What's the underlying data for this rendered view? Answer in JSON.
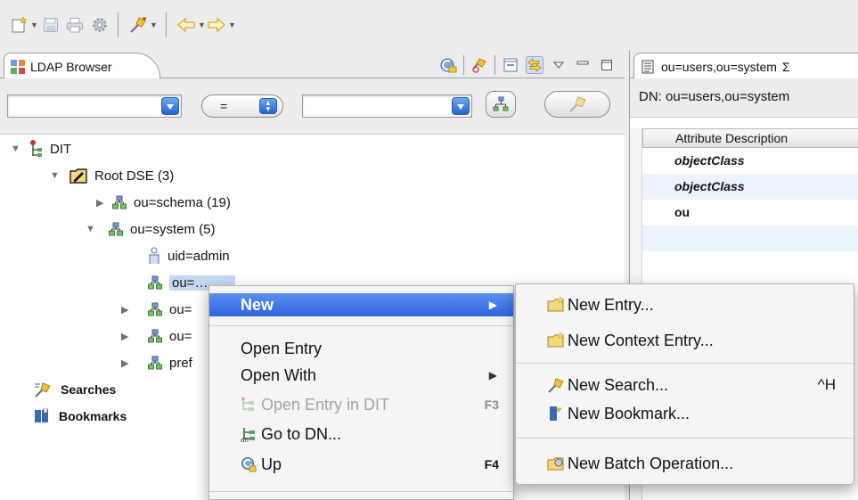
{
  "toolbar": {
    "items": [
      "new-wizard-icon",
      "save-icon",
      "print-icon",
      "preferences-icon",
      "search-icon",
      "back-icon",
      "forward-icon"
    ]
  },
  "left_view": {
    "tab_title": "LDAP Browser",
    "tools": [
      "connection-refresh-icon",
      "link-icon",
      "collapse-all-icon",
      "link-with-editor-icon",
      "view-menu-icon",
      "minimize-icon",
      "maximize-icon"
    ]
  },
  "filter": {
    "attribute_value": "",
    "operator": "=",
    "value": ""
  },
  "tree": {
    "dit": "DIT",
    "root_dse": "Root DSE (3)",
    "schema": "ou=schema (19)",
    "system": "ou=system (5)",
    "admin": "uid=admin",
    "selected_entry": "ou=…",
    "entry_3": "ou=",
    "entry_4": "ou=",
    "entry_5": "pref",
    "searches": "Searches",
    "bookmarks": "Bookmarks"
  },
  "editor": {
    "tab_title": "ou=users,ou=system",
    "close_glyph": "Σ",
    "dn": "DN: ou=users,ou=system",
    "column_header": "Attribute Description",
    "rows": [
      "objectClass",
      "objectClass",
      "ou"
    ]
  },
  "context_menu": {
    "new": "New",
    "open_entry": "Open Entry",
    "open_with": "Open With",
    "open_in_dit": "Open Entry in DIT",
    "open_in_dit_key": "F3",
    "go_to_dn": "Go to DN...",
    "up": "Up",
    "up_key": "F4"
  },
  "new_submenu": {
    "new_entry": "New Entry...",
    "new_context_entry": "New Context Entry...",
    "new_search": "New Search...",
    "new_search_key": "^H",
    "new_bookmark": "New Bookmark...",
    "new_batch": "New Batch Operation..."
  },
  "colors": {
    "highlight": "#3d74e6",
    "selection": "#c5d8f2",
    "combo_arrow": "#2166d2"
  }
}
